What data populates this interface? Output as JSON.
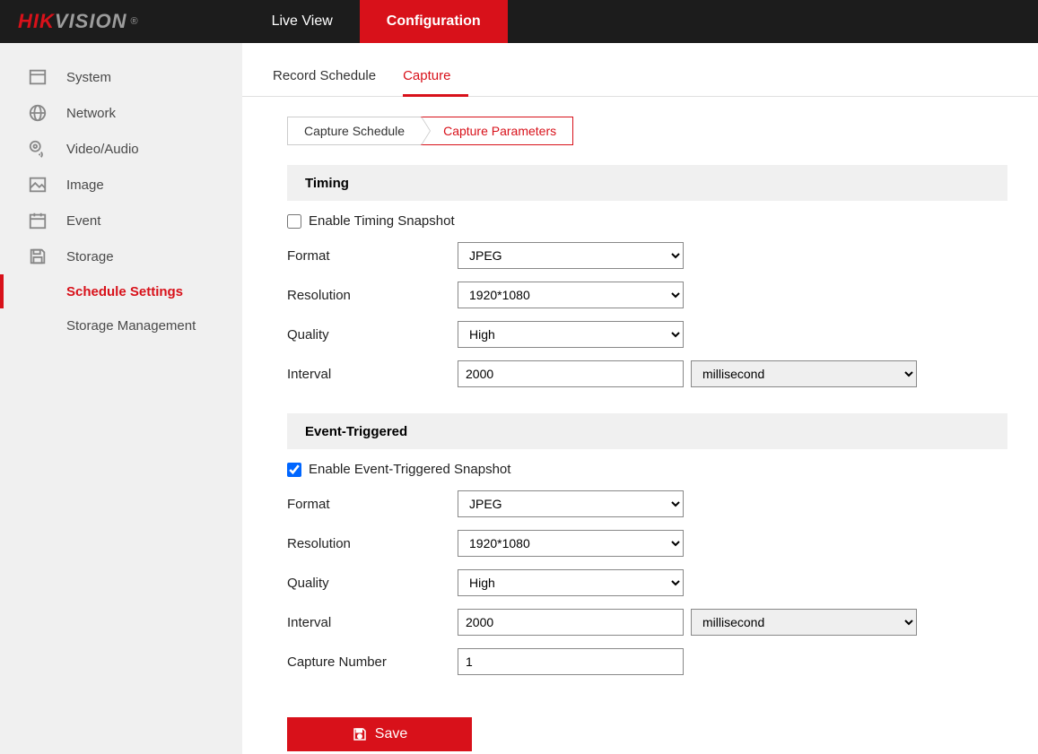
{
  "brand": {
    "part1": "HIK",
    "part2": "VISION",
    "reg": "®"
  },
  "nav": {
    "live_view": "Live View",
    "configuration": "Configuration"
  },
  "sidebar": {
    "items": [
      {
        "label": "System"
      },
      {
        "label": "Network"
      },
      {
        "label": "Video/Audio"
      },
      {
        "label": "Image"
      },
      {
        "label": "Event"
      },
      {
        "label": "Storage"
      }
    ],
    "children": [
      {
        "label": "Schedule Settings"
      },
      {
        "label": "Storage Management"
      }
    ]
  },
  "tabs": {
    "record_schedule": "Record Schedule",
    "capture": "Capture"
  },
  "breadcrumb": {
    "schedule": "Capture Schedule",
    "parameters": "Capture Parameters"
  },
  "timing": {
    "header": "Timing",
    "enable_label": "Enable Timing Snapshot",
    "enable_checked": false,
    "format_label": "Format",
    "format_value": "JPEG",
    "resolution_label": "Resolution",
    "resolution_value": "1920*1080",
    "quality_label": "Quality",
    "quality_value": "High",
    "interval_label": "Interval",
    "interval_value": "2000",
    "interval_unit": "millisecond"
  },
  "event": {
    "header": "Event-Triggered",
    "enable_label": "Enable Event-Triggered Snapshot",
    "enable_checked": true,
    "format_label": "Format",
    "format_value": "JPEG",
    "resolution_label": "Resolution",
    "resolution_value": "1920*1080",
    "quality_label": "Quality",
    "quality_value": "High",
    "interval_label": "Interval",
    "interval_value": "2000",
    "interval_unit": "millisecond",
    "capture_number_label": "Capture Number",
    "capture_number_value": "1"
  },
  "save_label": "Save"
}
